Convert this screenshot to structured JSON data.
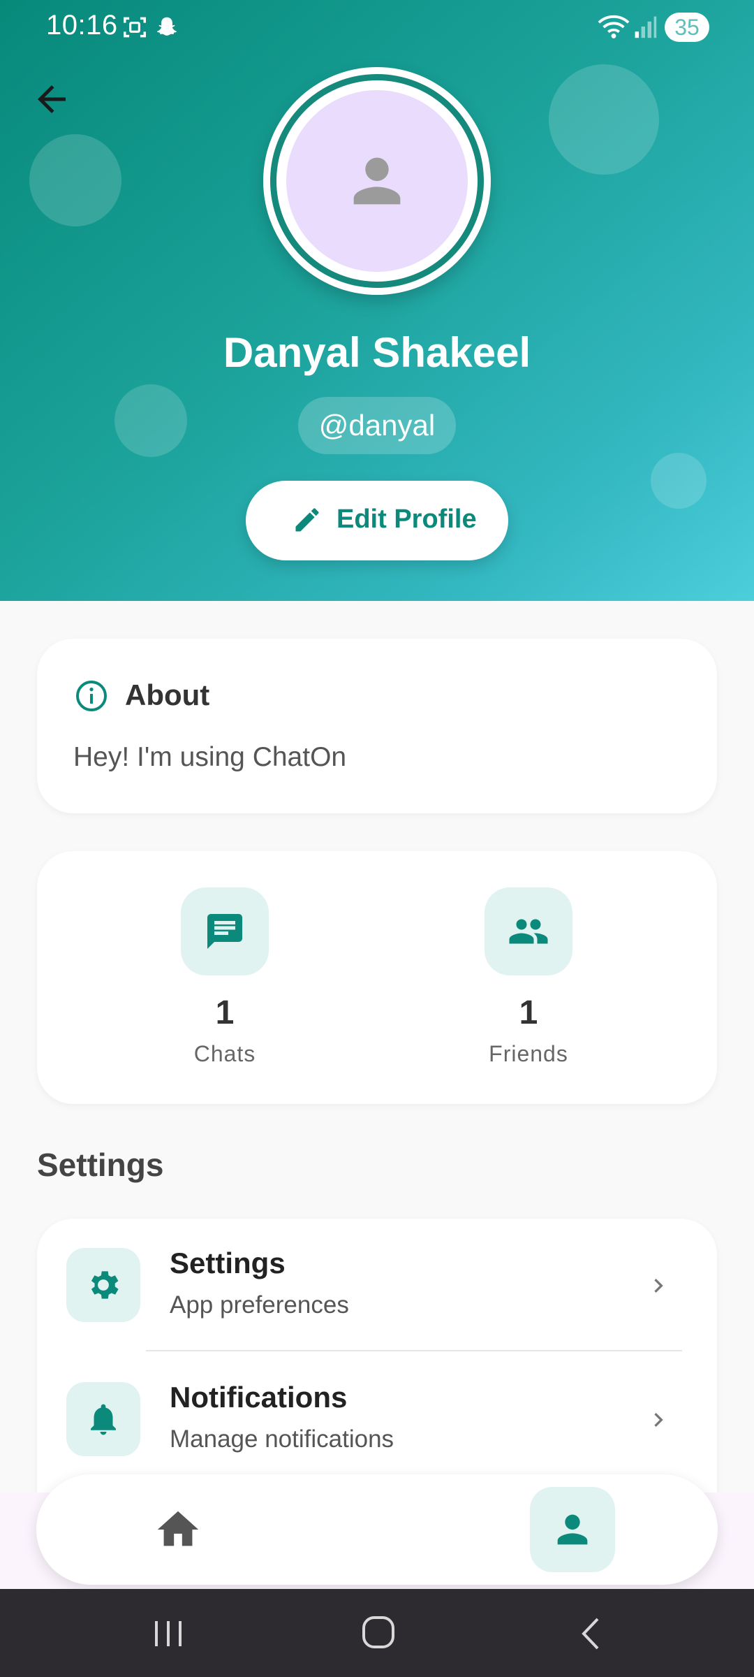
{
  "status_bar": {
    "time": "10:16",
    "battery": "35"
  },
  "profile": {
    "name": "Danyal Shakeel",
    "handle": "@danyal",
    "edit_label": "Edit Profile"
  },
  "about": {
    "title": "About",
    "text": "Hey! I'm using ChatOn"
  },
  "stats": [
    {
      "value": "1",
      "label": "Chats",
      "icon": "chat-icon"
    },
    {
      "value": "1",
      "label": "Friends",
      "icon": "people-icon"
    }
  ],
  "settings_section": {
    "title": "Settings",
    "items": [
      {
        "title": "Settings",
        "subtitle": "App preferences",
        "icon": "gear-icon"
      },
      {
        "title": "Notifications",
        "subtitle": "Manage notifications",
        "icon": "bell-icon"
      }
    ]
  },
  "colors": {
    "accent": "#0b8a7b",
    "header_start": "#07897a",
    "header_end": "#4ccfdb",
    "icon_bg": "#e1f3f1",
    "avatar_bg": "#e9dcfd"
  },
  "bottom_nav": {
    "items": [
      "home-icon",
      "profile-icon"
    ],
    "selected": "profile-icon"
  }
}
